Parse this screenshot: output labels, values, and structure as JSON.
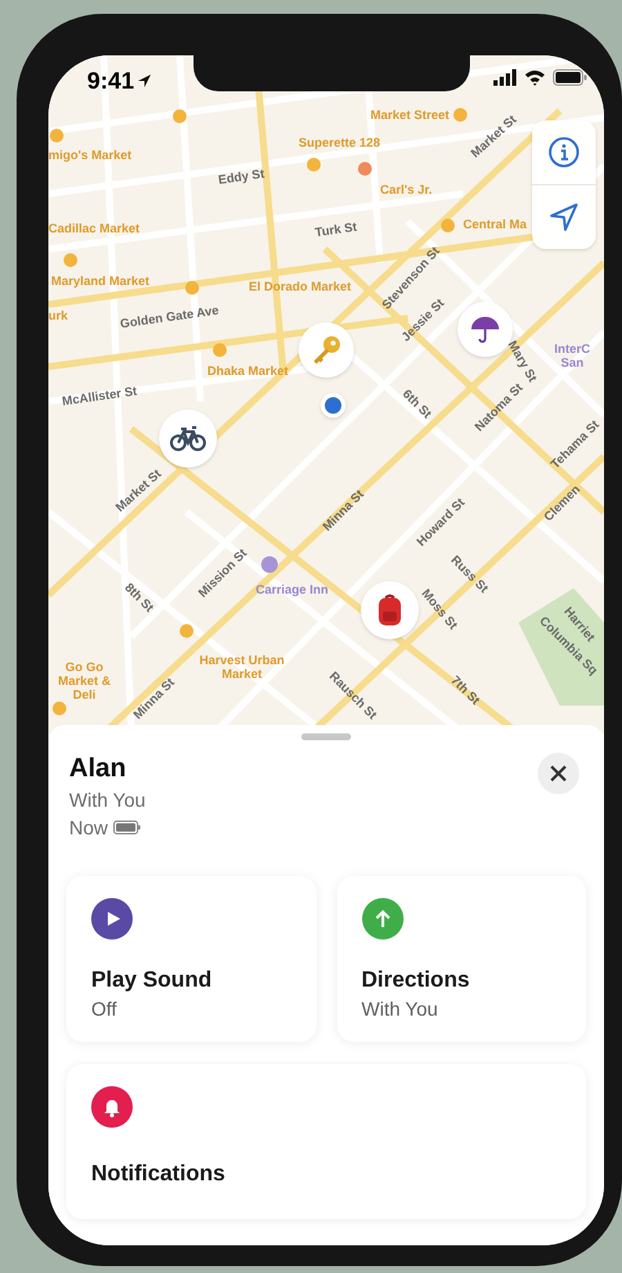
{
  "status_bar": {
    "time": "9:41"
  },
  "map": {
    "labels": [
      {
        "text": "Market Street",
        "kind": "poi"
      },
      {
        "text": "Superette 128",
        "kind": "poi"
      },
      {
        "text": "migo's Market",
        "kind": "poi"
      },
      {
        "text": "Eddy St",
        "kind": "street"
      },
      {
        "text": "Carl's Jr.",
        "kind": "poi"
      },
      {
        "text": "Market St",
        "kind": "street"
      },
      {
        "text": "Cadillac Market",
        "kind": "poi"
      },
      {
        "text": "Central Ma",
        "kind": "poi"
      },
      {
        "text": "Turk St",
        "kind": "street"
      },
      {
        "text": "Maryland Market",
        "kind": "poi"
      },
      {
        "text": "El Dorado Market",
        "kind": "poi"
      },
      {
        "text": "urk",
        "kind": "poi"
      },
      {
        "text": "Golden Gate Ave",
        "kind": "street"
      },
      {
        "text": "Stevenson St",
        "kind": "street"
      },
      {
        "text": "Jessie St",
        "kind": "street"
      },
      {
        "text": "Dhaka Market",
        "kind": "poi"
      },
      {
        "text": "Mary St",
        "kind": "street"
      },
      {
        "text": "InterC San",
        "kind": "place"
      },
      {
        "text": "McAllister St",
        "kind": "street"
      },
      {
        "text": "6th St",
        "kind": "street"
      },
      {
        "text": "Natoma St",
        "kind": "street"
      },
      {
        "text": "Market St",
        "kind": "street"
      },
      {
        "text": "Tehama St",
        "kind": "street"
      },
      {
        "text": "Clemen",
        "kind": "street"
      },
      {
        "text": "Minna St",
        "kind": "street"
      },
      {
        "text": "Howard St",
        "kind": "street"
      },
      {
        "text": "Mission St",
        "kind": "street"
      },
      {
        "text": "8th St",
        "kind": "street"
      },
      {
        "text": "Carriage Inn",
        "kind": "place"
      },
      {
        "text": "Russ St",
        "kind": "street"
      },
      {
        "text": "Moss St",
        "kind": "street"
      },
      {
        "text": "Harriet",
        "kind": "street"
      },
      {
        "text": "Columbia Sq",
        "kind": "street"
      },
      {
        "text": "Go Go Market & Deli",
        "kind": "poi"
      },
      {
        "text": "Harvest Urban Market",
        "kind": "poi"
      },
      {
        "text": "Rausch St",
        "kind": "street"
      },
      {
        "text": "7th St",
        "kind": "street"
      },
      {
        "text": "Minna St",
        "kind": "street"
      }
    ]
  },
  "sheet": {
    "name": "Alan",
    "status": "With You",
    "time": "Now",
    "actions": [
      {
        "title": "Play Sound",
        "subtitle": "Off",
        "color": "#5a4aa6"
      },
      {
        "title": "Directions",
        "subtitle": "With You",
        "color": "#3fae49"
      },
      {
        "title": "Notifications",
        "color": "#e21f4f"
      }
    ]
  }
}
